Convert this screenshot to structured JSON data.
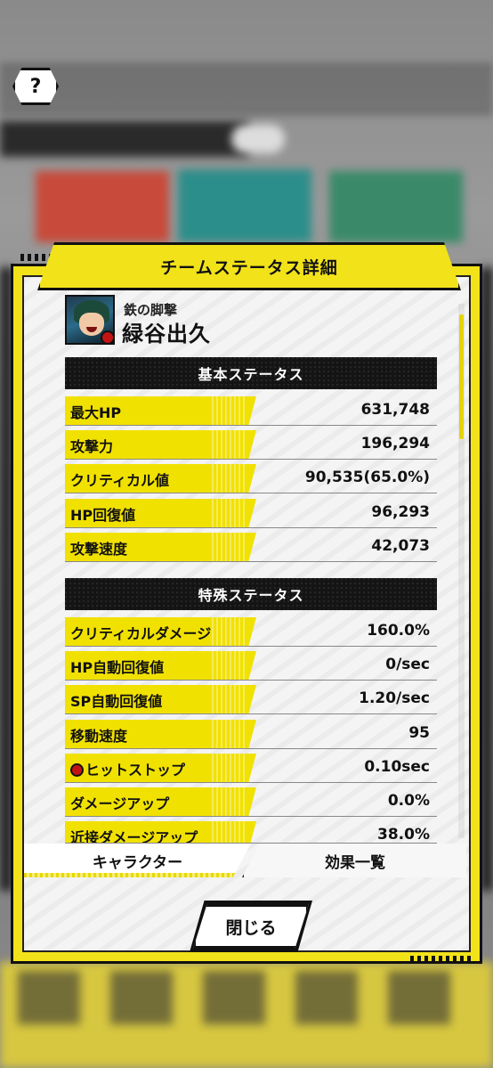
{
  "background": {
    "help_button": "?"
  },
  "modal": {
    "title": "チームステータス詳細",
    "character": {
      "epithet": "鉄の脚撃",
      "name": "緑谷出久"
    },
    "basic_section": {
      "title": "基本ステータス",
      "stats": [
        {
          "label": "最大HP",
          "value": "631,748"
        },
        {
          "label": "攻撃力",
          "value": "196,294"
        },
        {
          "label": "クリティカル値",
          "value": "90,535(65.0%)"
        },
        {
          "label": "HP回復値",
          "value": "96,293"
        },
        {
          "label": "攻撃速度",
          "value": "42,073"
        }
      ]
    },
    "special_section": {
      "title": "特殊ステータス",
      "stats": [
        {
          "label": "クリティカルダメージ",
          "value": "160.0%"
        },
        {
          "label": "HP自動回復値",
          "value": "0/sec"
        },
        {
          "label": "SP自動回復値",
          "value": "1.20/sec"
        },
        {
          "label": "移動速度",
          "value": "95"
        },
        {
          "label": "ヒットストップ",
          "value": "0.10sec",
          "icon": "badge-icon"
        },
        {
          "label": "ダメージアップ",
          "value": "0.0%"
        },
        {
          "label": "近接ダメージアップ",
          "value": "38.0%"
        }
      ]
    },
    "tabs": [
      {
        "label": "キャラクター",
        "active": true
      },
      {
        "label": "効果一覧",
        "active": false
      }
    ],
    "close_label": "閉じる"
  },
  "colors": {
    "accent": "#f2e21a",
    "section_bg": "#141414"
  }
}
